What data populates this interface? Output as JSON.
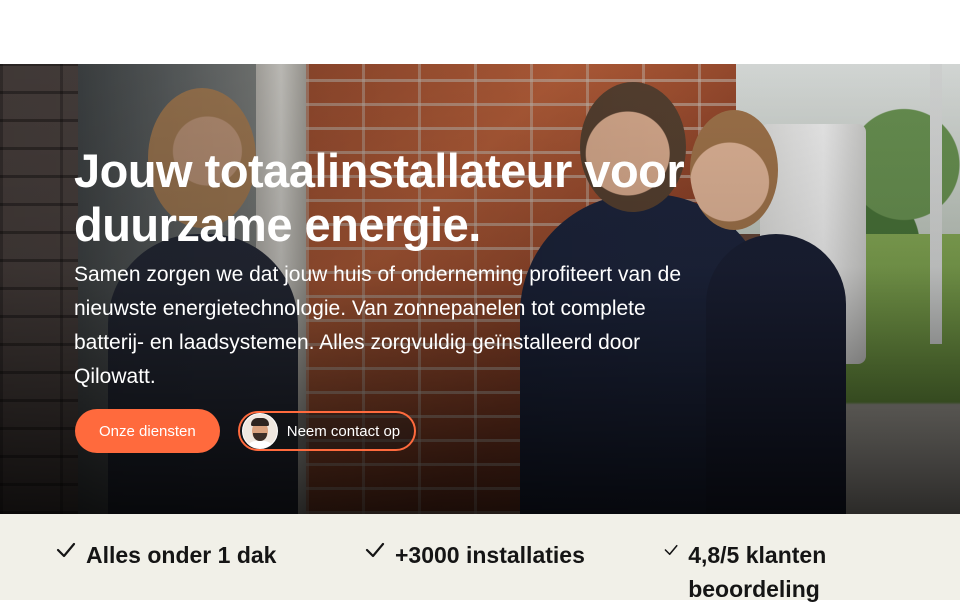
{
  "hero": {
    "title": "Jouw totaalinstallateur voor duurzame energie.",
    "text": "Samen zorgen we dat jouw huis of onderneming profiteert van de nieuwste energietechnologie. Van zonnepanelen tot complete batterij- en laadsystemen. Alles zorgvuldig geïnstalleerd door Qilowatt.",
    "primary_button": "Onze diensten",
    "secondary_button": "Neem contact op",
    "accent_color": "#ff6a3d"
  },
  "features": [
    {
      "label": "Alles onder 1 dak",
      "icon": "check-icon"
    },
    {
      "label": "+3000 installaties",
      "icon": "check-icon"
    },
    {
      "label": "4,8/5 klanten beoordeling",
      "icon": "check-icon"
    }
  ],
  "colors": {
    "feature_bar_bg": "#f1f0e8",
    "text_dark": "#151515"
  }
}
